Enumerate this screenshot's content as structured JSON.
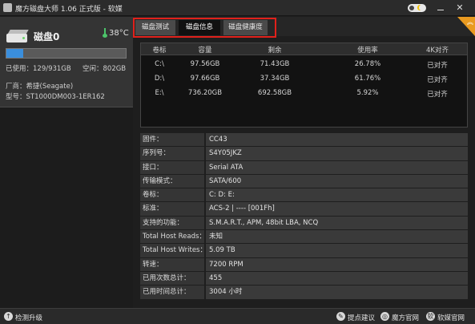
{
  "window": {
    "title": "魔方磁盘大师 1.06 正式版 - 软媒"
  },
  "disk": {
    "name": "磁盘0",
    "temperature": "38°C",
    "used": "已使用：129/931GB",
    "free": "空闲：802GB",
    "usage_fraction": 0.139,
    "vendor": "厂商：希捷(Seagate)",
    "model": "型号：ST1000DM003-1ER162"
  },
  "tabs": [
    "磁盘测试",
    "磁盘信息",
    "磁盘健康度"
  ],
  "partitions": {
    "headers": [
      "卷标",
      "容量",
      "剩余",
      "使用率",
      "4K对齐"
    ],
    "rows": [
      [
        "C:\\",
        "97.56GB",
        "71.43GB",
        "26.78%",
        "已对齐"
      ],
      [
        "D:\\",
        "97.66GB",
        "37.34GB",
        "61.76%",
        "已对齐"
      ],
      [
        "E:\\",
        "736.20GB",
        "692.58GB",
        "5.92%",
        "已对齐"
      ]
    ]
  },
  "info": [
    {
      "label": "固件：",
      "value": "CC43"
    },
    {
      "label": "序列号：",
      "value": "S4Y05JKZ"
    },
    {
      "label": "接口：",
      "value": "Serial ATA"
    },
    {
      "label": "传输模式：",
      "value": "SATA/600"
    },
    {
      "label": "卷标：",
      "value": "C: D: E:"
    },
    {
      "label": "标准：",
      "value": "ACS-2 | ---- [001Fh]"
    },
    {
      "label": "支持的功能：",
      "value": "S.M.A.R.T., APM, 48bit LBA, NCQ"
    },
    {
      "label": "Total Host Reads：",
      "value": "未知"
    },
    {
      "label": "Total Host Writes：",
      "value": "5.09 TB"
    },
    {
      "label": "转速：",
      "value": "7200 RPM"
    },
    {
      "label": "已用次数总计：",
      "value": "455"
    },
    {
      "label": "已用时间总计：",
      "value": "3004 小时"
    }
  ],
  "statusbar": {
    "upgrade": "检测升级",
    "feedback": "提点建议",
    "official_site": "魔方官网",
    "ruanmei_site": "软媒官网"
  },
  "icons": {
    "upgrade": "arrow-up-icon",
    "feedback": "pen-icon",
    "official_site": "globe-icon",
    "ruanmei_site": "ruanmei-logo-icon"
  },
  "colors": {
    "tab_highlight": "#e0211b",
    "usage_fill": "#3a8edc",
    "corner_badge": "#e99a20",
    "temperature_icon": "#4cc46a"
  }
}
